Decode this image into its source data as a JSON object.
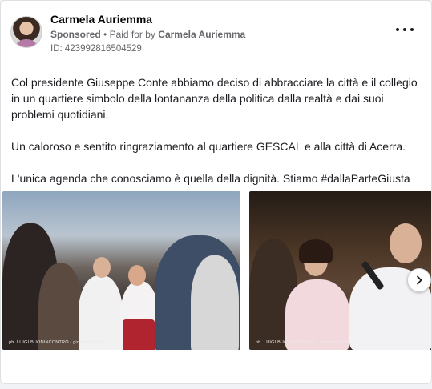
{
  "post": {
    "author": "Carmela Auriemma",
    "sponsored_label": "Sponsored",
    "separator": "•",
    "paid_for_by_prefix": "Paid for by",
    "paid_for_by_name": "Carmela Auriemma",
    "id_label": "ID: 423992816504529",
    "paragraphs": [
      "Col presidente Giuseppe Conte abbiamo deciso di abbracciare la città e il collegio in un quartiere simbolo della lontananza della politica dalla realtà e dai suoi problemi quotidiani.",
      "Un caloroso e sentito ringraziamento al quartiere GESCAL e alla città di Acerra.",
      "L'unica agenda che conosciamo è quella della dignità. Stiamo #dallaParteGiusta"
    ]
  },
  "carousel": {
    "images": [
      {
        "credit": "ph. LUIGI BUONINCONTRO - giornale Tablò"
      },
      {
        "credit": "ph. LUIGI BUONINCONTRO - giornale Tablò"
      }
    ],
    "next_icon": "chevron-right-icon"
  },
  "colors": {
    "name": "#050505",
    "secondary_text": "#65676b",
    "card_border": "#dddfe2"
  }
}
